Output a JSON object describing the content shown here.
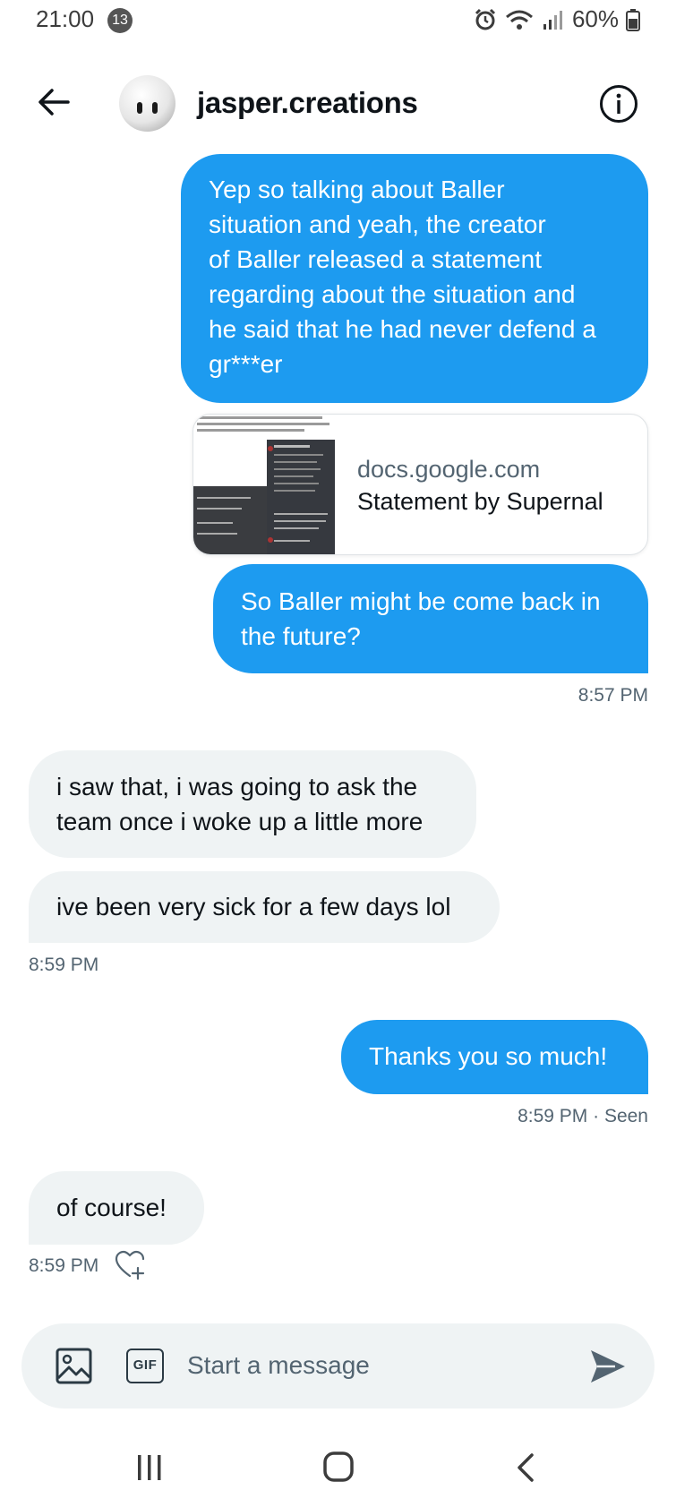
{
  "status_bar": {
    "time": "21:00",
    "notification_count": "13",
    "battery": "60%",
    "icons": [
      "alarm-icon",
      "wifi-icon",
      "signal-icon",
      "battery-icon"
    ]
  },
  "header": {
    "contact_name": "jasper.creations",
    "icons": [
      "back-arrow-icon",
      "info-icon"
    ]
  },
  "messages": [
    {
      "direction": "outgoing",
      "text": "Yep so talking about Baller\nsituation and yeah, the creator\nof Baller released a statement\nregarding about the situation and\nhe said that he had never defend a\ngr***er"
    },
    {
      "direction": "outgoing",
      "type": "link-card",
      "domain": "docs.google.com",
      "title": "Statement by Supernal"
    },
    {
      "direction": "outgoing",
      "text": "So Baller might be come back in\nthe future?"
    },
    {
      "direction": "incoming",
      "text": "i saw that, i was going to ask the\nteam once i woke up a little more"
    },
    {
      "direction": "incoming",
      "text": "ive been very sick for a few days lol"
    },
    {
      "direction": "outgoing",
      "text": "Thanks you so much!"
    },
    {
      "direction": "incoming",
      "text": "of course!"
    }
  ],
  "timestamps": {
    "t1": "8:57 PM",
    "t2": "8:59 PM",
    "t3": "8:59 PM · Seen",
    "t4": "8:59 PM"
  },
  "composer": {
    "placeholder": "Start a message",
    "gif_label": "GIF",
    "icons": [
      "image-icon",
      "gif-icon",
      "send-icon"
    ]
  },
  "navbar": {
    "icons": [
      "recents-icon",
      "home-icon",
      "nav-back-icon"
    ]
  },
  "colors": {
    "outgoing_bubble": "#1d9bf0",
    "incoming_bubble": "#eff3f4",
    "secondary_text": "#536471"
  }
}
